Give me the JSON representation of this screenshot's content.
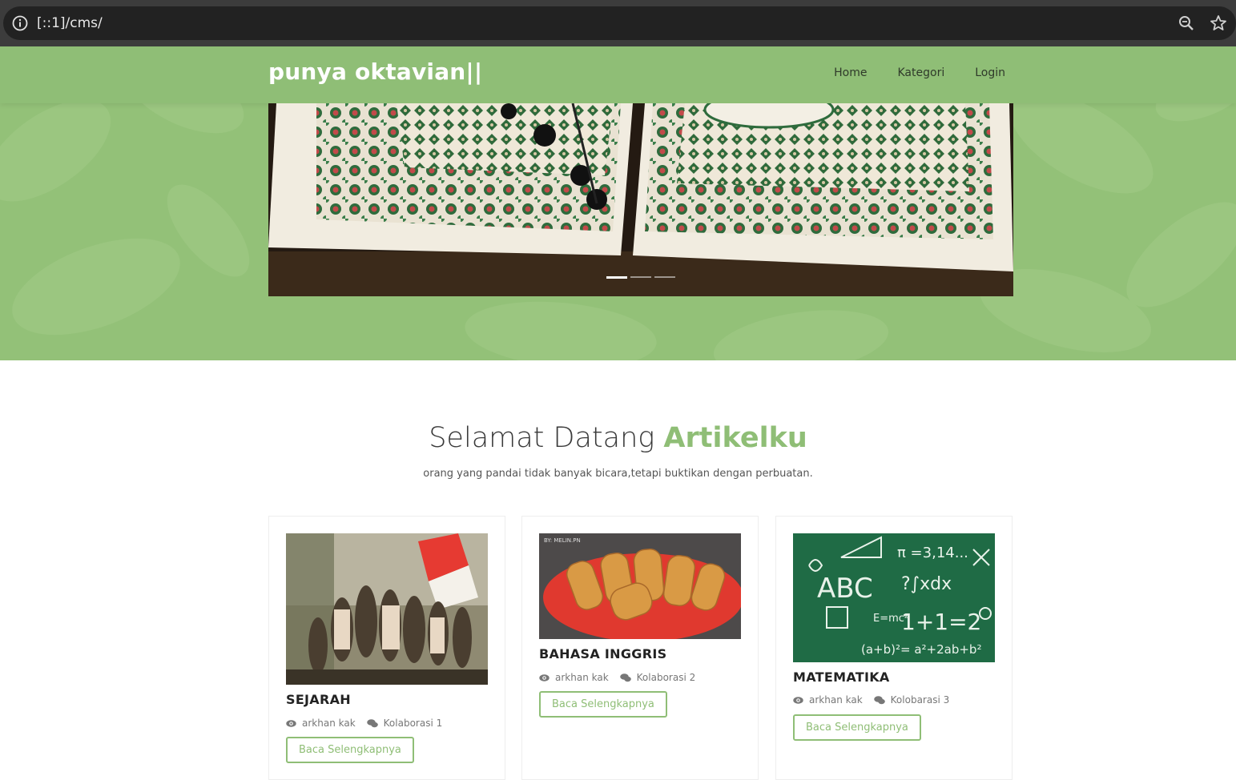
{
  "browser": {
    "url": "[::1]/cms/"
  },
  "navbar": {
    "brand": "punya oktavian||",
    "links": [
      "Home",
      "Kategori",
      "Login"
    ]
  },
  "slider": {
    "slide_count": 3,
    "active_index": 0
  },
  "welcome": {
    "title_plain": "Selamat Datang ",
    "title_accent": "Artikelku",
    "tagline": "orang yang pandai tidak banyak bicara,tetapi buktikan dengan perbuatan."
  },
  "cards": [
    {
      "title": "SEJARAH",
      "author": "arkhan kak",
      "category": "Kolaborasi 1",
      "button": "Baca Selengkapnya"
    },
    {
      "title": "BAHASA INGGRIS",
      "author": "arkhan kak",
      "category": "Kolaborasi 2",
      "button": "Baca Selengkapnya"
    },
    {
      "title": "MATEMATIKA",
      "author": "arkhan kak",
      "category": "Kolobarasi 3",
      "button": "Baca Selengkapnya"
    }
  ],
  "colors": {
    "accent": "#8fbe76",
    "chrome": "#3c3c3c"
  },
  "icons": {
    "views": "eye-icon",
    "category": "comments-icon"
  }
}
